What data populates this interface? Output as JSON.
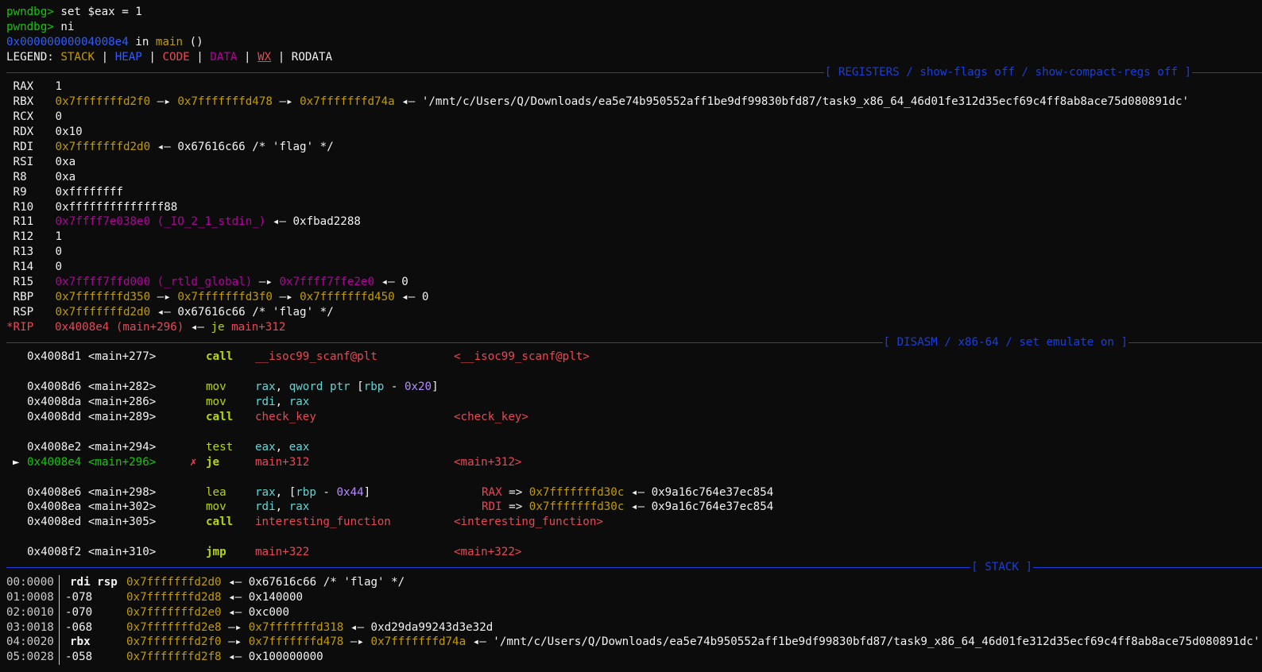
{
  "prompt": "pwndbg>",
  "cmd1": " set $eax = 1",
  "cmd2": " ni",
  "location": {
    "addr": "0x00000000004008e4",
    "in": " in ",
    "func": "main",
    "args": " ()"
  },
  "legend": {
    "label": "LEGEND: ",
    "stack": "STACK",
    "heap": "HEAP",
    "code": "CODE",
    "data": "DATA",
    "wx": "WX",
    "rodata": "RODATA",
    "sep": " | "
  },
  "banners": {
    "registers": "[ REGISTERS / show-flags off / show-compact-regs off ]",
    "disasm": "[ DISASM / x86-64 / set emulate on ]",
    "stack": "[ STACK ]"
  },
  "registers": {
    "rax": {
      "name": "RAX",
      "val": "1"
    },
    "rbx": {
      "name": "RBX",
      "p1": "0x7fffffffd2f0",
      "a1": " —▸ ",
      "p2": "0x7fffffffd478",
      "a2": " —▸ ",
      "p3": "0x7fffffffd74a",
      "a3": " ◂— ",
      "str": "'/mnt/c/Users/Q/Downloads/ea5e74b950552aff1be9df99830bfd87/task9_x86_64_46d01fe312d35ecf69c4ff8ab8ace75d080891dc'"
    },
    "rcx": {
      "name": "RCX",
      "val": "0"
    },
    "rdx": {
      "name": "RDX",
      "val": "0x10"
    },
    "rdi": {
      "name": "RDI",
      "p1": "0x7fffffffd2d0",
      "a1": " ◂— ",
      "rest": "0x67616c66 /* 'flag' */"
    },
    "rsi": {
      "name": "RSI",
      "val": "0xa"
    },
    "r8": {
      "name": "R8",
      "val": "0xa"
    },
    "r9": {
      "name": "R9",
      "val": "0xffffffff"
    },
    "r10": {
      "name": "R10",
      "val": "0xffffffffffffff88"
    },
    "r11": {
      "name": "R11",
      "p1": "0x7ffff7e038e0 (_IO_2_1_stdin_)",
      "a1": " ◂— ",
      "rest": "0xfbad2288"
    },
    "r12": {
      "name": "R12",
      "val": "1"
    },
    "r13": {
      "name": "R13",
      "val": "0"
    },
    "r14": {
      "name": "R14",
      "val": "0"
    },
    "r15": {
      "name": "R15",
      "p1": "0x7ffff7ffd000 (_rtld_global)",
      "a1": " —▸ ",
      "p2": "0x7ffff7ffe2e0",
      "a2": " ◂— ",
      "rest": "0"
    },
    "rbp": {
      "name": "RBP",
      "p1": "0x7fffffffd350",
      "a1": " —▸ ",
      "p2": "0x7fffffffd3f0",
      "a2": " —▸ ",
      "p3": "0x7fffffffd450",
      "a3": " ◂— ",
      "rest": "0"
    },
    "rsp": {
      "name": "RSP",
      "p1": "0x7fffffffd2d0",
      "a1": " ◂— ",
      "rest": "0x67616c66 /* 'flag' */"
    },
    "rip": {
      "name": "*RIP",
      "p1": "0x4008e4 (main+296)",
      "a1": " ◂— ",
      "ins": "je",
      "target": " main+312"
    }
  },
  "disasm": [
    {
      "addr": "0x4008d1 <main+277>",
      "mn": "call",
      "ops": "__isoc99_scanf@plt",
      "note": "<__isoc99_scanf@plt>"
    },
    {
      "addr": "0x4008d6 <main+282>",
      "mn": "mov",
      "o1": "rax",
      "o2": ", ",
      "o3": "qword ptr",
      "o4": " [",
      "o5": "rbp",
      "o6": " - ",
      "o7": "0x20",
      "o8": "]"
    },
    {
      "addr": "0x4008da <main+286>",
      "mn": "mov",
      "o1": "rdi",
      "o2": ", ",
      "o3": "rax"
    },
    {
      "addr": "0x4008dd <main+289>",
      "mn": "call",
      "ops": "check_key",
      "note": "<check_key>"
    },
    {
      "addr": "0x4008e2 <main+294>",
      "mn": "test",
      "o1": "eax",
      "o2": ", ",
      "o3": "eax"
    },
    {
      "marker": "►",
      "addr": "0x4008e4 <main+296>",
      "x": "✗",
      "mn": "je",
      "ops": "main+312",
      "note": "<main+312>"
    },
    {
      "addr": "0x4008e6 <main+298>",
      "mn": "lea",
      "o1": "rax",
      "o2": ", [",
      "o3": "rbp",
      "o4": " - ",
      "o5": "0x44",
      "o6": "]",
      "reg": "RAX",
      "arrow": " => ",
      "ptr": "0x7fffffffd30c",
      "a": " ◂— ",
      "val": "0x9a16c764e37ec854"
    },
    {
      "addr": "0x4008ea <main+302>",
      "mn": "mov",
      "o1": "rdi",
      "o2": ", ",
      "o3": "rax",
      "reg": "RDI",
      "arrow": " => ",
      "ptr": "0x7fffffffd30c",
      "a": " ◂— ",
      "val": "0x9a16c764e37ec854"
    },
    {
      "addr": "0x4008ed <main+305>",
      "mn": "call",
      "ops": "interesting_function",
      "note": "<interesting_function>"
    },
    {
      "addr": "0x4008f2 <main+310>",
      "mn": "jmp",
      "ops": "main+322",
      "note": "<main+322>"
    }
  ],
  "stack": [
    {
      "idx": "00:0000",
      "lbl": "rdi rsp",
      "p1": "0x7fffffffd2d0",
      "a1": " ◂— ",
      "rest": "0x67616c66 /* 'flag' */"
    },
    {
      "idx": "01:0008",
      "lbl": "-078",
      "p1": "0x7fffffffd2d8",
      "a1": " ◂— ",
      "rest": "0x140000"
    },
    {
      "idx": "02:0010",
      "lbl": "-070",
      "p1": "0x7fffffffd2e0",
      "a1": " ◂— ",
      "rest": "0xc000"
    },
    {
      "idx": "03:0018",
      "lbl": "-068",
      "p1": "0x7fffffffd2e8",
      "a1": " —▸ ",
      "p2": "0x7fffffffd318",
      "a2": " ◂— ",
      "rest": "0xd29da99243d3e32d"
    },
    {
      "idx": "04:0020",
      "lbl": "rbx",
      "p1": "0x7fffffffd2f0",
      "a1": " —▸ ",
      "p2": "0x7fffffffd478",
      "a2": " —▸ ",
      "p3": "0x7fffffffd74a",
      "a3": " ◂— ",
      "rest": "'/mnt/c/Users/Q/Downloads/ea5e74b950552aff1be9df99830bfd87/task9_x86_64_46d01fe312d35ecf69c4ff8ab8ace75d080891dc'"
    },
    {
      "idx": "05:0028",
      "lbl": "-058",
      "p1": "0x7fffffffd2f8",
      "a1": " ◂— ",
      "rest": "0x100000000"
    }
  ],
  "colors": {
    "prompt": "#16c60c",
    "stack": "#c19c00",
    "heap": "#2f5cff",
    "code": "#e74856",
    "data": "#b4009e",
    "banner": "#1a3edc"
  }
}
